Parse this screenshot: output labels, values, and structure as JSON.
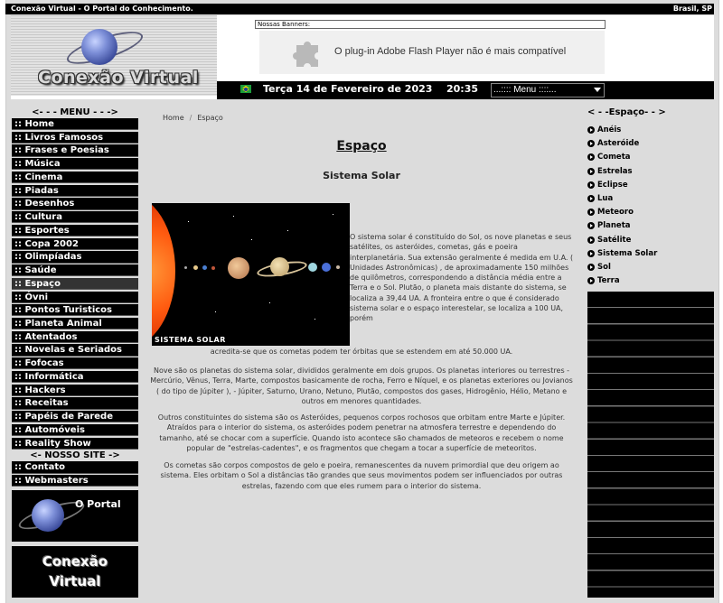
{
  "topbar": {
    "title": "Conexão Virtual - O Portal do Conhecimento.",
    "location": "Brasil, SP"
  },
  "header": {
    "logo_text": "Conexão Virtual",
    "banners_label": "Nossas Banners:",
    "flash_message": "O plug-in Adobe Flash Player não é mais compatível",
    "date": "Terça 14 de Fevereiro de 2023",
    "time": "20:35",
    "menu_select": "...:::: Menu ::::..."
  },
  "left_menu": {
    "title": "<- - - MENU - - ->",
    "items": [
      ":: Home",
      ":: Livros Famosos",
      ":: Frases e Poesias",
      ":: Música",
      ":: Cinema",
      ":: Piadas",
      ":: Desenhos",
      ":: Cultura",
      ":: Esportes",
      ":: Copa 2002",
      ":: Olimpíadas",
      ":: Saúde",
      ":: Espaço",
      ":: Óvni",
      ":: Pontos Turisticos",
      ":: Planeta Animal",
      ":: Atentados",
      ":: Novelas e Seriados",
      ":: Fofocas",
      ":: Informática",
      ":: Hackers",
      ":: Receitas",
      ":: Papéis de Parede",
      ":: Automóveis",
      ":: Reality Show"
    ],
    "site_title": "<- NOSSO SITE ->",
    "site_items": [
      ":: Contato",
      ":: Webmasters"
    ],
    "banner1_text": "O Portal",
    "banner2_line1": "Conexão",
    "banner2_line2": "Virtual"
  },
  "breadcrumb": {
    "home": "Home",
    "sep": "/",
    "current": "Espaço"
  },
  "content": {
    "title": "Espaço",
    "subtitle": "Sistema Solar",
    "image_label": "SISTEMA SOLAR",
    "paragraph1": "O sistema solar é constituído do Sol, os nove planetas e seus satélites, os asteróides, cometas, gás e poeira interplanetária. Sua extensão geralmente é medida em U.A. ( Unidades Astronômicas) , de aproximadamente 150 milhões de quilômetros, correspondendo a distância média entre a Terra e o Sol. Plutão, o planeta mais distante do sistema, se localiza a 39,44 UA. A fronteira entre o que é considerado sistema solar e o espaço interestelar, se localiza a 100 UA, porém",
    "paragraph1b": "acredita-se que os cometas podem ter órbitas que se estendem em até 50.000 UA.",
    "paragraph2": "Nove são os planetas do sistema solar, divididos geralmente em dois grupos. Os planetas interiores ou terrestres - Mercúrio, Vênus, Terra, Marte, compostos basicamente de rocha, Ferro e Níquel, e os planetas exteriores ou Jovianos ( do tipo de Júpiter ), - Júpiter, Saturno, Urano, Netuno, Plutão, compostos dos gases, Hidrogênio, Hélio, Metano e outros em menores quantidades.",
    "paragraph3": "Outros constituintes do sistema são os Asteróides, pequenos corpos rochosos que orbitam entre Marte e Júpiter. Atraídos para o interior do sistema, os asteróides podem penetrar na atmosfera terrestre e dependendo do tamanho, até se chocar com a superfície. Quando isto acontece são chamados de meteoros e recebem o nome popular de \"estrelas-cadentes\", e os fragmentos que chegam a tocar a superfície de meteoritos.",
    "paragraph4": "Os cometas são corpos compostos de gelo e poeira, remanescentes da nuvem primordial que deu origem ao sistema. Eles orbitam o Sol a distâncias tão grandes que seus movimentos podem ser influenciados por outras estrelas, fazendo com que eles rumem para o interior do sistema."
  },
  "right_menu": {
    "title": "< - -Espaço- - >",
    "items": [
      "Anéis",
      "Asteróide",
      "Cometa",
      "Estrelas",
      "Eclipse",
      "Lua",
      "Meteoro",
      "Planeta",
      "Satélite",
      "Sistema Solar",
      "Sol",
      "Terra"
    ]
  }
}
